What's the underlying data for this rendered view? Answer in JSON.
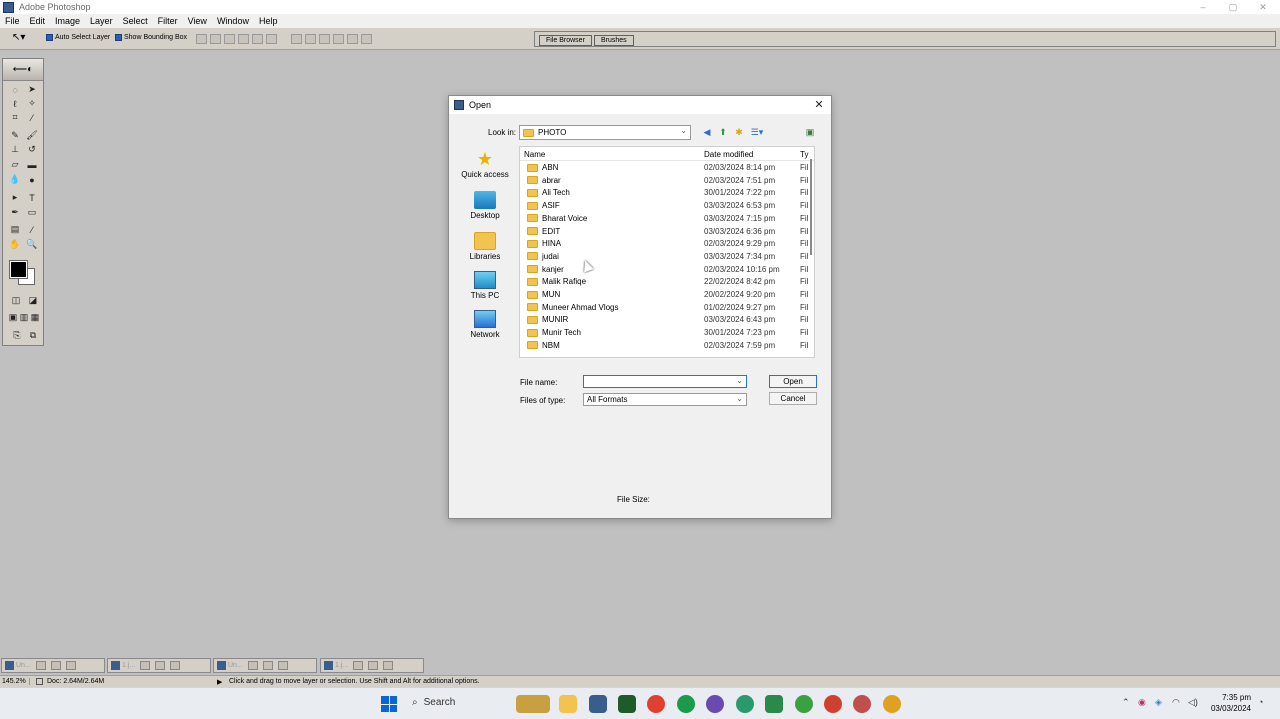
{
  "app": {
    "title": "Adobe Photoshop",
    "window_controls": [
      "–",
      "▢",
      "✕"
    ]
  },
  "menubar": [
    "File",
    "Edit",
    "Image",
    "Layer",
    "Select",
    "Filter",
    "View",
    "Window",
    "Help"
  ],
  "options": {
    "tool_glyph": "↖▾",
    "auto_select": "Auto Select Layer",
    "bounding_box": "Show Bounding Box"
  },
  "palette_well": {
    "tabs": [
      "File Browser",
      "Brushes"
    ]
  },
  "toolbox": {
    "head_glyph": "⟵◐",
    "tools": [
      {
        "name": "marquee",
        "glyph": "◌"
      },
      {
        "name": "move",
        "glyph": "➤"
      },
      {
        "name": "lasso",
        "glyph": "ℓ"
      },
      {
        "name": "magic-wand",
        "glyph": "✧"
      },
      {
        "name": "crop",
        "glyph": "⌗"
      },
      {
        "name": "slice",
        "glyph": "⁄"
      },
      {
        "name": "healing",
        "glyph": "✎"
      },
      {
        "name": "brush",
        "glyph": "🖌"
      },
      {
        "name": "stamp",
        "glyph": "⊥"
      },
      {
        "name": "history-brush",
        "glyph": "↺"
      },
      {
        "name": "eraser",
        "glyph": "▱"
      },
      {
        "name": "gradient",
        "glyph": "▬"
      },
      {
        "name": "blur",
        "glyph": "💧"
      },
      {
        "name": "dodge",
        "glyph": "●"
      },
      {
        "name": "path-select",
        "glyph": "▸"
      },
      {
        "name": "type",
        "glyph": "T"
      },
      {
        "name": "pen",
        "glyph": "✒"
      },
      {
        "name": "shape",
        "glyph": "▭"
      },
      {
        "name": "notes",
        "glyph": "▤"
      },
      {
        "name": "eyedropper",
        "glyph": "⁄"
      },
      {
        "name": "hand",
        "glyph": "✋"
      },
      {
        "name": "zoom",
        "glyph": "🔍"
      }
    ],
    "bottom_glyphs": [
      "◫",
      "◪",
      "▣",
      "▥",
      "▦",
      "⎘",
      "⧉"
    ]
  },
  "dialog": {
    "title": "Open",
    "close_glyph": "✕",
    "look_in_label": "Look in:",
    "look_in_value": "PHOTO",
    "nav_glyphs": [
      "◀",
      "⬆",
      "✱",
      "☰▾"
    ],
    "places": [
      "Quick access",
      "Desktop",
      "Libraries",
      "This PC",
      "Network"
    ],
    "columns": {
      "name": "Name",
      "date": "Date modified",
      "type": "Ty"
    },
    "rows": [
      {
        "name": "ABN",
        "date": "02/03/2024 8:14 pm",
        "type": "Fil"
      },
      {
        "name": "abrar",
        "date": "02/03/2024 7:51 pm",
        "type": "Fil"
      },
      {
        "name": "Ali Tech",
        "date": "30/01/2024 7:22 pm",
        "type": "Fil"
      },
      {
        "name": "ASIF",
        "date": "03/03/2024 6:53 pm",
        "type": "Fil"
      },
      {
        "name": "Bharat Voice",
        "date": "03/03/2024 7:15 pm",
        "type": "Fil"
      },
      {
        "name": "EDIT",
        "date": "03/03/2024 6:36 pm",
        "type": "Fil"
      },
      {
        "name": "HINA",
        "date": "02/03/2024 9:29 pm",
        "type": "Fil"
      },
      {
        "name": "judai",
        "date": "03/03/2024 7:34 pm",
        "type": "Fil"
      },
      {
        "name": "kanjer",
        "date": "02/03/2024 10:16 pm",
        "type": "Fil"
      },
      {
        "name": "Malik Rafiqe",
        "date": "22/02/2024 8:42 pm",
        "type": "Fil"
      },
      {
        "name": "MUN",
        "date": "20/02/2024 9:20 pm",
        "type": "Fil"
      },
      {
        "name": "Muneer Ahmad Vlogs",
        "date": "01/02/2024 9:27 pm",
        "type": "Fil"
      },
      {
        "name": "MUNIR",
        "date": "03/03/2024 6:43 pm",
        "type": "Fil"
      },
      {
        "name": "Munir Tech",
        "date": "30/01/2024 7:23 pm",
        "type": "Fil"
      },
      {
        "name": "NBM",
        "date": "02/03/2024 7:59 pm",
        "type": "Fil"
      }
    ],
    "file_name_label": "File name:",
    "file_name_value": "",
    "files_of_type_label": "Files of type:",
    "files_of_type_value": "All Formats",
    "open_button": "Open",
    "cancel_button": "Cancel",
    "file_size_label": "File Size:"
  },
  "minimized_docs": [
    "Un...",
    "1.j...",
    "Un...",
    "1.j..."
  ],
  "statusbar": {
    "zoom": "145.2%",
    "doc": "Doc: 2.64M/2.64M",
    "hint": "Click and drag to move layer or selection. Use Shift and Alt for additional options."
  },
  "taskbar": {
    "search": "Search",
    "time": "7:35 pm",
    "date": "03/03/2024"
  },
  "colors": {
    "canvas_bg": "#c0c0c0",
    "folder": "#f2c44f",
    "accent": "#2a6fd6"
  }
}
